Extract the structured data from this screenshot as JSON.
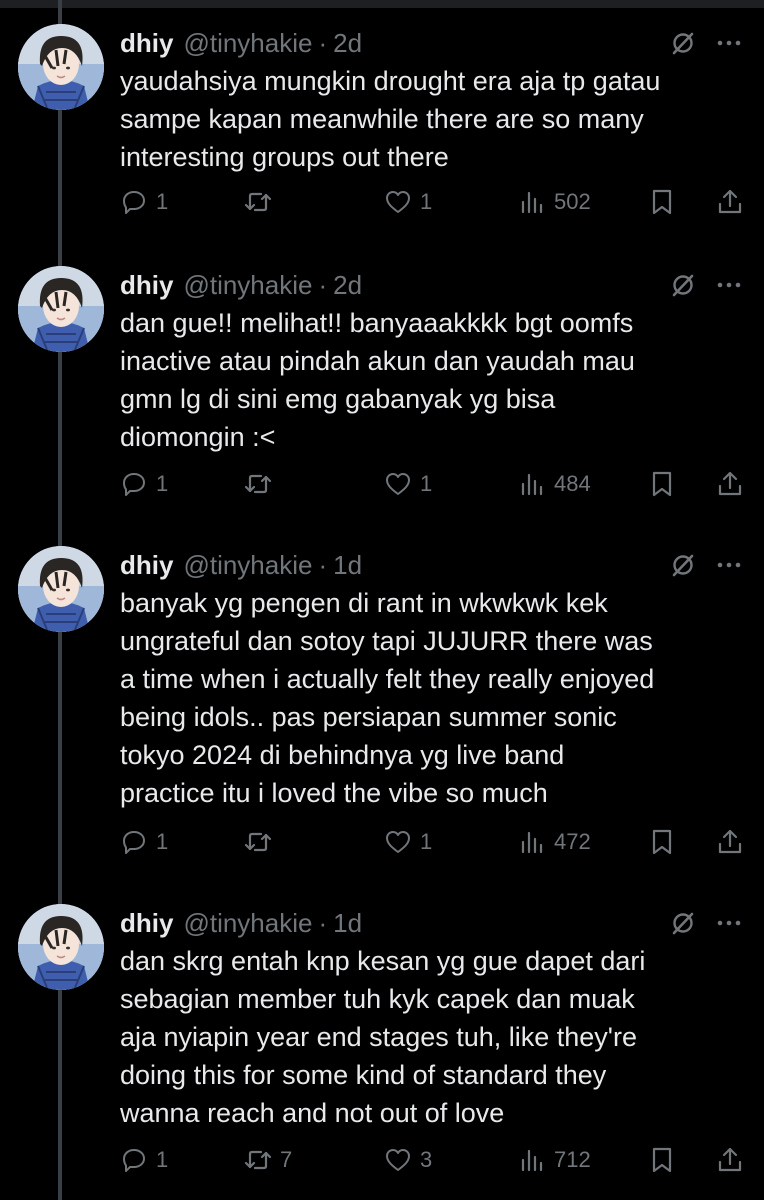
{
  "tweets": [
    {
      "name": "dhiy",
      "handle": "@tinyhakie",
      "separator": "·",
      "time": "2d",
      "text": "yaudahsiya mungkin drought era aja tp gatau\nsampe kapan meanwhile there are so many\ninteresting groups out there",
      "replies": "1",
      "retweets": "",
      "likes": "1",
      "views": "502"
    },
    {
      "name": "dhiy",
      "handle": "@tinyhakie",
      "separator": "·",
      "time": "2d",
      "text": "dan gue!! melihat!! banyaaakkkk bgt oomfs\ninactive atau pindah akun dan yaudah mau\ngmn lg di sini emg gabanyak yg bisa\ndiomongin :<",
      "replies": "1",
      "retweets": "",
      "likes": "1",
      "views": "484"
    },
    {
      "name": "dhiy",
      "handle": "@tinyhakie",
      "separator": "·",
      "time": "1d",
      "text": "banyak yg pengen di rant in wkwkwk kek\nungrateful dan sotoy tapi JUJURR there was\na time when i actually felt they really enjoyed\nbeing idols.. pas persiapan summer sonic\ntokyo 2024 di behindnya yg live band\npractice itu i loved the vibe so much",
      "replies": "1",
      "retweets": "",
      "likes": "1",
      "views": "472"
    },
    {
      "name": "dhiy",
      "handle": "@tinyhakie",
      "separator": "·",
      "time": "1d",
      "text": "dan skrg entah knp kesan yg gue dapet dari\nsebagian member tuh kyk capek dan muak\naja nyiapin year end stages tuh, like they're\ndoing this for some kind of standard they\nwanna reach and not out of love",
      "replies": "1",
      "retweets": "7",
      "likes": "3",
      "views": "712"
    }
  ],
  "icons": {
    "reply": "reply-icon",
    "retweet": "retweet-icon",
    "like": "heart-icon",
    "views": "views-icon",
    "bookmark": "bookmark-icon",
    "share": "share-icon",
    "grok": "grok-icon",
    "more": "more-icon"
  },
  "colors": {
    "background": "#000000",
    "text": "#e7e9ea",
    "muted": "#71767b",
    "thread_line": "#3a3f45"
  }
}
